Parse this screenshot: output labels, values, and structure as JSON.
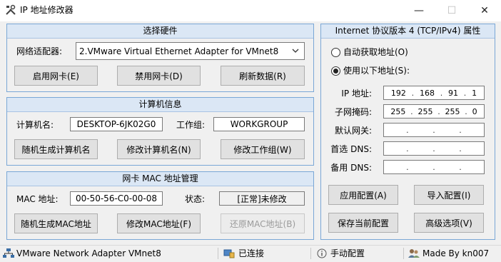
{
  "window": {
    "title": "IP 地址修改器",
    "minimize_glyph": "—",
    "maximize_glyph": "☐",
    "close_glyph": "✕"
  },
  "hardware": {
    "header": "选择硬件",
    "adapter_label": "网络适配器:",
    "adapter_selected": "2.VMware Virtual Ethernet Adapter for VMnet8",
    "enable_button": "启用网卡(E)",
    "disable_button": "禁用网卡(D)",
    "refresh_button": "刷新数据(R)"
  },
  "computer": {
    "header": "计算机信息",
    "name_label": "计算机名:",
    "name_value": "DESKTOP-6JK02G0",
    "workgroup_label": "工作组:",
    "workgroup_value": "WORKGROUP",
    "random_name_button": "随机生成计算机名",
    "change_name_button": "修改计算机名(N)",
    "change_workgroup_button": "修改工作组(W)"
  },
  "mac": {
    "header": "网卡 MAC 地址管理",
    "mac_label": "MAC 地址:",
    "mac_value": "00-50-56-C0-00-08",
    "status_label": "状态:",
    "status_value": "[正常]未修改",
    "random_mac_button": "随机生成MAC地址",
    "change_mac_button": "修改MAC地址(F)",
    "restore_mac_button": "还原MAC地址(B)"
  },
  "ipv4": {
    "header": "Internet 协议版本 4 (TCP/IPv4) 属性",
    "auto_option": "自动获取地址(O)",
    "manual_option": "使用以下地址(S):",
    "selected_option": "manual",
    "ip_label": "IP 地址:",
    "ip": [
      "192",
      "168",
      "91",
      "1"
    ],
    "mask_label": "子网掩码:",
    "mask": [
      "255",
      "255",
      "255",
      "0"
    ],
    "gateway_label": "默认网关:",
    "gateway": [
      "",
      "",
      "",
      ""
    ],
    "dns1_label": "首选 DNS:",
    "dns1": [
      "",
      "",
      "",
      ""
    ],
    "dns2_label": "备用 DNS:",
    "dns2": [
      "",
      "",
      "",
      ""
    ],
    "apply_button": "应用配置(A)",
    "import_button": "导入配置(I)",
    "save_button": "保存当前配置",
    "advanced_button": "高级选项(V)"
  },
  "statusbar": {
    "adapter": "VMware Network Adapter VMnet8",
    "connection": "已连接",
    "mode": "手动配置",
    "author": "Made By kn007"
  }
}
